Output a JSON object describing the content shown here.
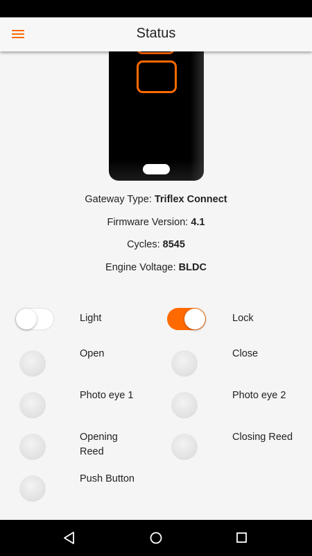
{
  "app_bar": {
    "title": "Status"
  },
  "gateway_info": [
    {
      "label": "Gateway Type: ",
      "value": "Triflex Connect"
    },
    {
      "label": "Firmware Version: ",
      "value": "4.1"
    },
    {
      "label": "Cycles: ",
      "value": "8545"
    },
    {
      "label": "Engine Voltage: ",
      "value": "BLDC"
    }
  ],
  "toggles": {
    "light": {
      "label": "Light",
      "on": false
    },
    "lock": {
      "label": "Lock",
      "on": true
    }
  },
  "indicators": {
    "open": "Open",
    "close": "Close",
    "photo_eye_1": "Photo eye 1",
    "photo_eye_2": "Photo eye 2",
    "opening_reed_line1": "Opening",
    "opening_reed_line2": "Reed",
    "closing_reed": "Closing Reed",
    "push_button": "Push Button"
  },
  "colors": {
    "accent": "#ff6a00",
    "background": "#f5f5f5",
    "system_bars": "#000000"
  },
  "icons": {
    "menu": "hamburger-menu-icon",
    "nav_back": "back-triangle-icon",
    "nav_home": "home-circle-icon",
    "nav_recents": "recents-square-icon"
  }
}
